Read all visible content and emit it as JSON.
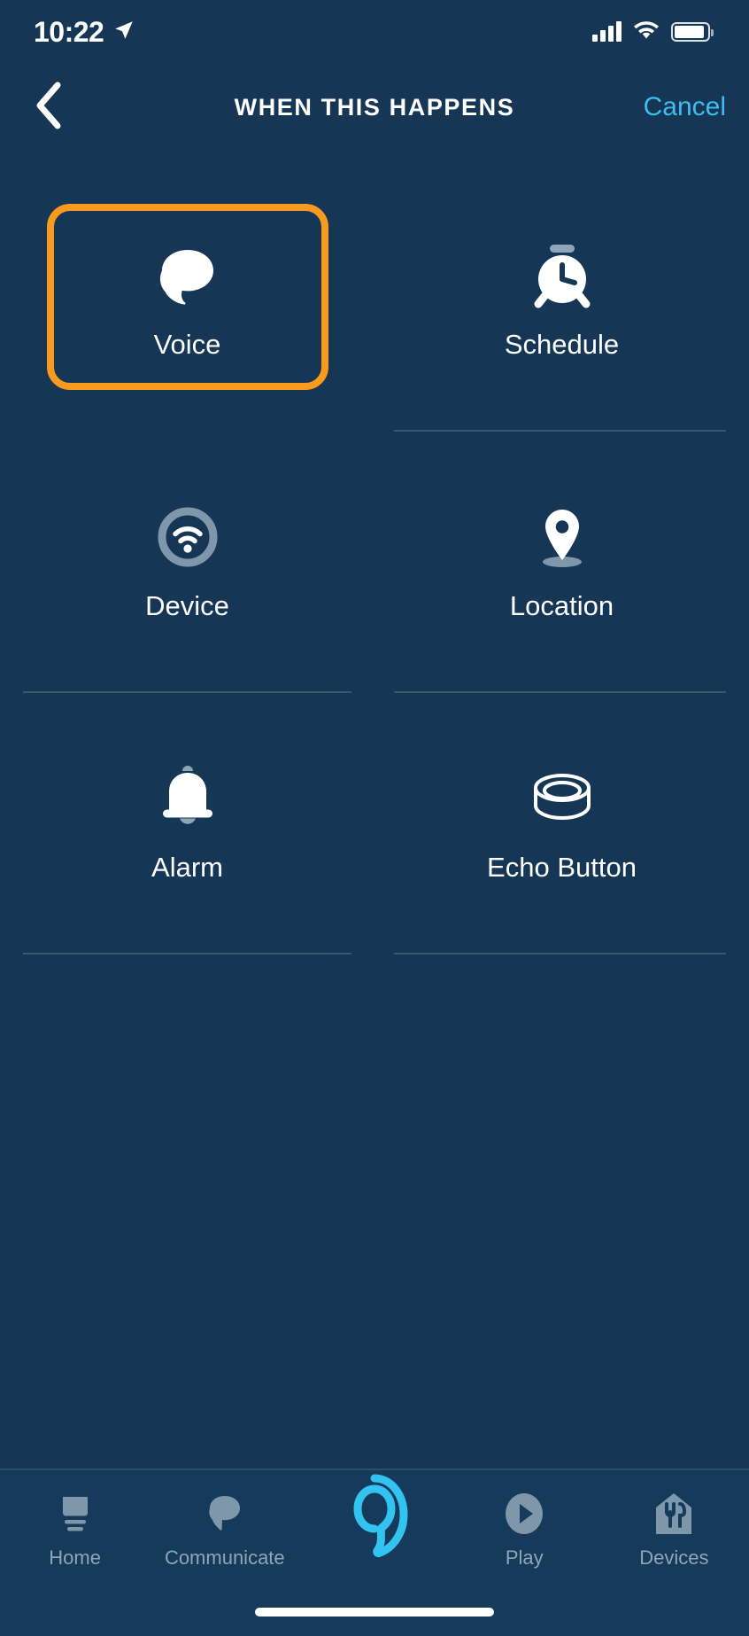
{
  "status_bar": {
    "time": "10:22",
    "location_arrow_icon": "location-arrow-icon",
    "signal_icon": "cellular-signal-icon",
    "wifi_icon": "wifi-icon",
    "battery_icon": "battery-icon"
  },
  "header": {
    "back_icon": "chevron-left-icon",
    "title": "WHEN THIS HAPPENS",
    "cancel_label": "Cancel",
    "cancel_color": "#3fbdee"
  },
  "trigger_grid": {
    "selected_index": 0,
    "selection_color": "#f89a1e",
    "items": [
      {
        "label": "Voice",
        "icon": "speech-bubble-icon",
        "selected": true
      },
      {
        "label": "Schedule",
        "icon": "alarm-clock-icon",
        "selected": false
      },
      {
        "label": "Device",
        "icon": "wifi-circle-icon",
        "selected": false
      },
      {
        "label": "Location",
        "icon": "map-pin-icon",
        "selected": false
      },
      {
        "label": "Alarm",
        "icon": "bell-icon",
        "selected": false
      },
      {
        "label": "Echo Button",
        "icon": "echo-puck-icon",
        "selected": false
      }
    ]
  },
  "tab_bar": {
    "active_tab": "alexa",
    "alexa_ring_color": "#33c3f0",
    "tabs": [
      {
        "label": "Home",
        "icon": "home-icon"
      },
      {
        "label": "Communicate",
        "icon": "chat-bubble-icon"
      },
      {
        "label": "",
        "icon": "alexa-ring-icon"
      },
      {
        "label": "Play",
        "icon": "play-circle-icon"
      },
      {
        "label": "Devices",
        "icon": "devices-house-icon"
      }
    ]
  },
  "theme": {
    "background": "#153755",
    "tab_bar_background": "#163a59"
  }
}
